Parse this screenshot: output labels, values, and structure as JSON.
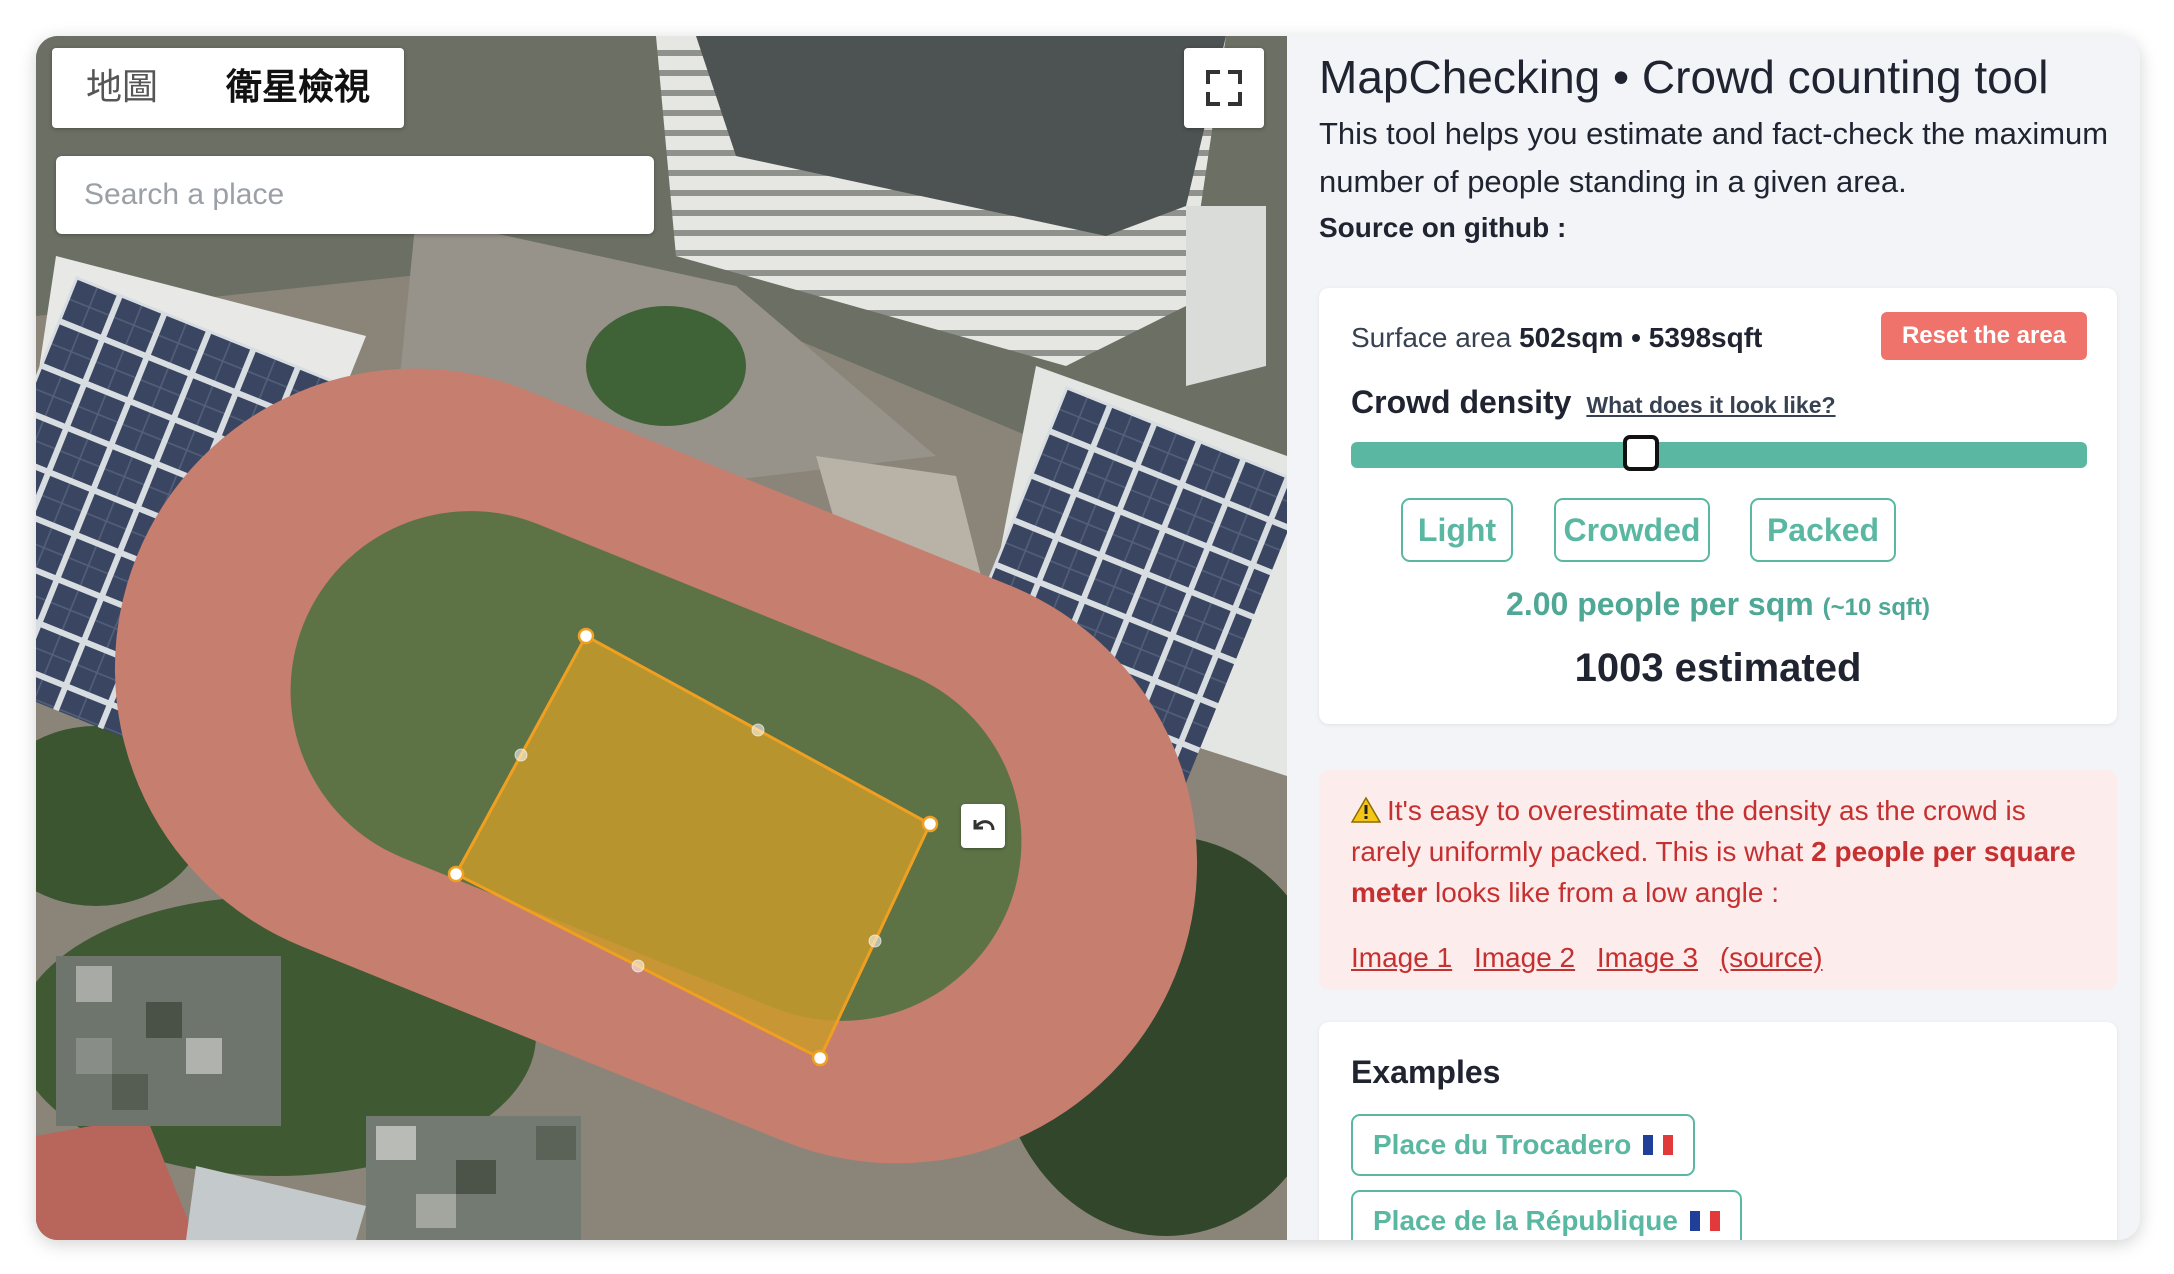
{
  "map": {
    "tabs": [
      {
        "label": "地圖",
        "active": false
      },
      {
        "label": "衛星檢視",
        "active": true
      }
    ],
    "search": {
      "placeholder": "Search a place",
      "value": ""
    },
    "icons": {
      "fullscreen": "fullscreen-icon",
      "undo": "undo-icon"
    }
  },
  "panel": {
    "title": "MapChecking • Crowd counting tool",
    "description": "This tool helps you estimate and fact-check the maximum number of people standing in a given area.",
    "source_label": "Source on github :",
    "area": {
      "label": "Surface area",
      "value": "502sqm • 5398sqft",
      "reset_label": "Reset the area"
    },
    "density": {
      "label": "Crowd density",
      "link": "What does it look like?",
      "slider_fraction": 0.393,
      "presets": [
        "Light",
        "Crowded",
        "Packed"
      ],
      "rate": "2.00 people per sqm",
      "rate_note": "(~10 sqft)",
      "estimate": "1003 estimated"
    },
    "warning": {
      "icon": "warning-icon",
      "text_1": "It's easy to overestimate the density as the crowd is rarely uniformly packed. This is what ",
      "text_bold": "2 people per square meter",
      "text_2": " looks like from a low angle :",
      "links": [
        "Image 1",
        "Image 2",
        "Image 3"
      ],
      "source_link": "(source)"
    },
    "examples": {
      "title": "Examples",
      "items": [
        "Place du Trocadero",
        "Place de la République"
      ]
    }
  },
  "colors": {
    "accent": "#5ab8a2",
    "reset": "#f0736b",
    "warning_bg": "#fdecec",
    "warning_text": "#c53030",
    "polygon_fill": "#c89a2c",
    "polygon_stroke": "#f0a020"
  }
}
